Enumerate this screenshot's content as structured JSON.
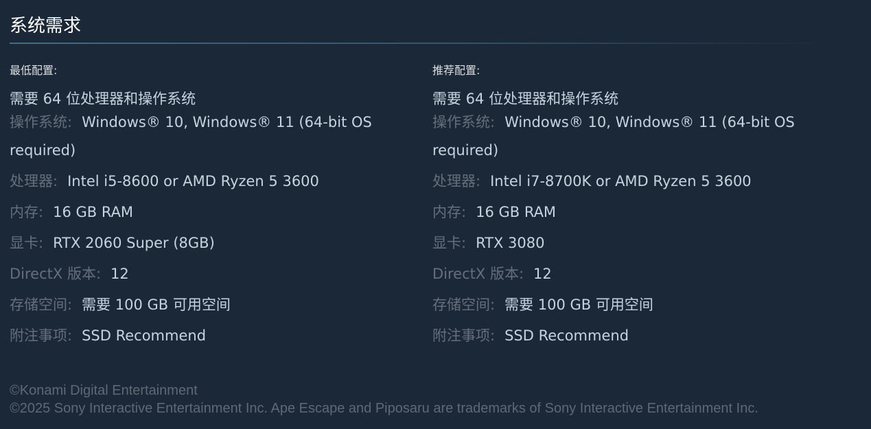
{
  "section_title": "系统需求",
  "minimum": {
    "heading": "最低配置:",
    "bits_note": "需要 64 位处理器和操作系统",
    "specs": [
      {
        "label": "操作系统:",
        "value": "Windows® 10, Windows® 11 (64-bit OS required)"
      },
      {
        "label": "处理器:",
        "value": "Intel i5-8600 or AMD Ryzen 5 3600"
      },
      {
        "label": "内存:",
        "value": "16 GB RAM"
      },
      {
        "label": "显卡:",
        "value": "RTX 2060 Super (8GB)"
      },
      {
        "label": "DirectX 版本:",
        "value": "12"
      },
      {
        "label": "存储空间:",
        "value": "需要 100 GB 可用空间"
      },
      {
        "label": "附注事项:",
        "value": "SSD Recommend"
      }
    ]
  },
  "recommended": {
    "heading": "推荐配置:",
    "bits_note": "需要 64 位处理器和操作系统",
    "specs": [
      {
        "label": "操作系统:",
        "value": "Windows® 10, Windows® 11 (64-bit OS required)"
      },
      {
        "label": "处理器:",
        "value": "Intel i7-8700K or AMD Ryzen 5 3600"
      },
      {
        "label": "内存:",
        "value": "16 GB RAM"
      },
      {
        "label": "显卡:",
        "value": "RTX 3080"
      },
      {
        "label": "DirectX 版本:",
        "value": "12"
      },
      {
        "label": "存储空间:",
        "value": "需要 100 GB 可用空间"
      },
      {
        "label": "附注事项:",
        "value": "SSD Recommend"
      }
    ]
  },
  "legal": {
    "line1": "©Konami Digital Entertainment",
    "line2": "©2025 Sony Interactive Entertainment Inc. Ape Escape and Piposaru are trademarks of Sony Interactive Entertainment Inc."
  },
  "colors": {
    "background": "#1b2838",
    "title": "#ffffff",
    "label": "#636f7a",
    "value": "#c6d4df",
    "legal": "#5d6974",
    "rule": "#3b6e8f"
  }
}
